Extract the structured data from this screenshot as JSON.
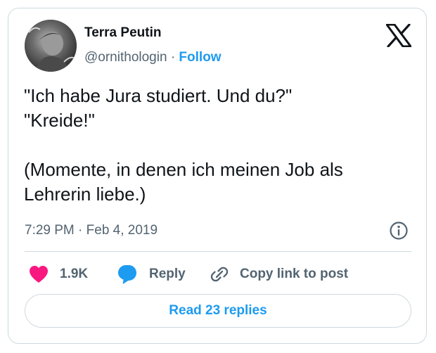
{
  "author": {
    "display_name": "Terra Peutin",
    "handle": "@ornithologin",
    "separator": "·",
    "follow_label": "Follow"
  },
  "tweet": {
    "lines": [
      "\"Ich habe Jura studiert. Und du?\"",
      "\"Kreide!\"",
      "",
      "(Momente, in denen ich meinen Job als",
      "Lehrerin liebe.)"
    ],
    "timestamp": "7:29 PM · Feb 4, 2019"
  },
  "actions": {
    "like_count": "1.9K",
    "reply_label": "Reply",
    "copy_link_label": "Copy link to post"
  },
  "read_replies_label": "Read 23 replies",
  "colors": {
    "accent": "#1d9bf0",
    "like": "#f91880",
    "reply_icon": "#1d9bf0",
    "secondary_text": "#536471",
    "primary_text": "#0f1419",
    "border": "#cfd9de"
  },
  "icons": {
    "brand": "x-logo-icon",
    "info": "info-icon",
    "like": "heart-icon",
    "reply": "speech-bubble-icon",
    "copy": "link-icon"
  }
}
